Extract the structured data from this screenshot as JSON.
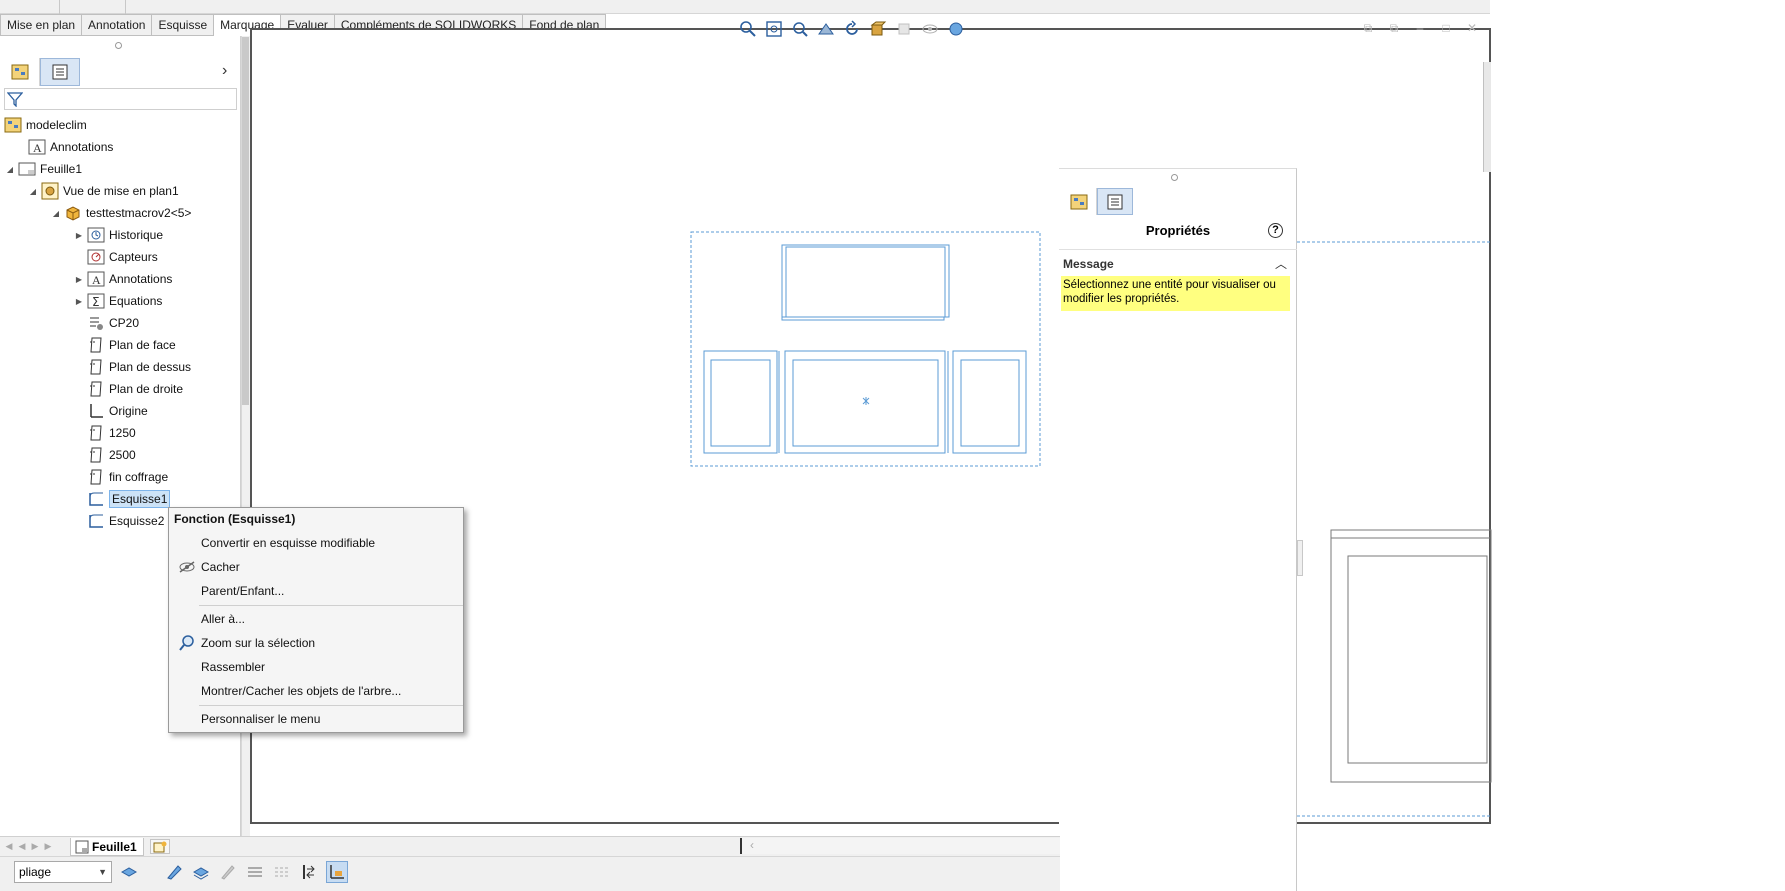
{
  "tabs": [
    "Mise en plan",
    "Annotation",
    "Esquisse",
    "Marquage",
    "Evaluer",
    "Compléments de SOLIDWORKS",
    "Fond de plan"
  ],
  "active_tab": "Marquage",
  "tree": {
    "root": "modeleclim",
    "annotations": "Annotations",
    "sheet": "Feuille1",
    "view": "Vue de mise en plan1",
    "part": "testtestmacrov2<5>",
    "historique": "Historique",
    "capteurs": "Capteurs",
    "part_annotations": "Annotations",
    "equations": "Equations",
    "cp20": "CP20",
    "plan_face": "Plan de face",
    "plan_dessus": "Plan de dessus",
    "plan_droite": "Plan de droite",
    "origine": "Origine",
    "p1250": "1250",
    "p2500": "2500",
    "fin_coffrage": "fin coffrage",
    "esquisse1": "Esquisse1",
    "esquisse2": "Esquisse2"
  },
  "context_menu": {
    "header": "Fonction (Esquisse1)",
    "convert": "Convertir en esquisse modifiable",
    "hide": "Cacher",
    "parent_child": "Parent/Enfant...",
    "goto": "Aller à...",
    "zoom_selection": "Zoom sur la sélection",
    "collapse": "Rassembler",
    "show_hide_tree": "Montrer/Cacher les objets de l'arbre...",
    "customize": "Personnaliser le menu"
  },
  "property_manager": {
    "title": "Propriétés",
    "help": "?",
    "message_title": "Message",
    "message_text": "Sélectionnez une entité pour visualiser ou modifier les propriétés."
  },
  "sheet_tab": "Feuille1",
  "layer": "pliage",
  "colors": {
    "accent": "#1f6fd1",
    "drawing_line": "#5b9bd5",
    "message_bg": "#ffff80",
    "selection_bg": "#cde3f7"
  },
  "icons": {
    "hud": [
      "zoom-fit-icon",
      "zoom-area-icon",
      "zoom-prev-icon",
      "section-view-icon",
      "rotate-icon",
      "view-orientation-icon",
      "display-style-icon",
      "hide-show-icon",
      "scene-icon",
      "appearance-icon"
    ]
  }
}
